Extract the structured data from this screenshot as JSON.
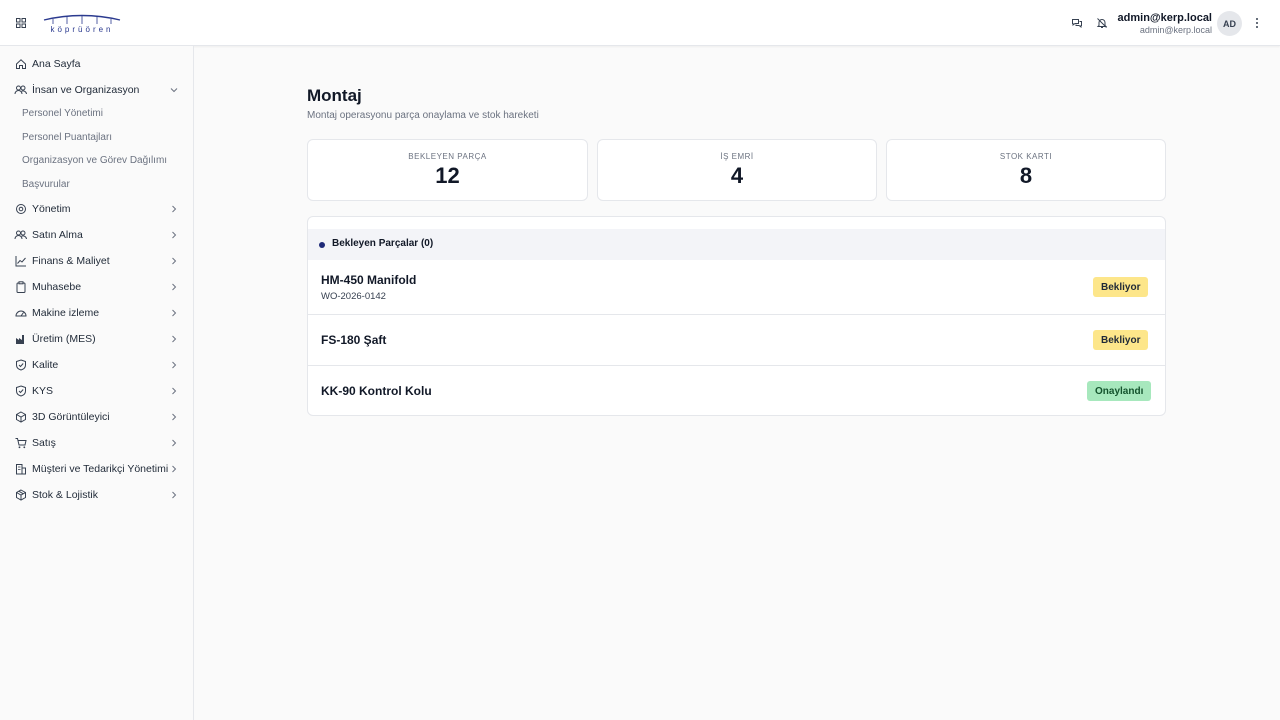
{
  "header": {
    "logo_text": "köprüören",
    "user_name": "admin@kerp.local",
    "user_email": "admin@kerp.local",
    "avatar_initials": "AD"
  },
  "sidebar": {
    "home": "Ana Sayfa",
    "hr": {
      "label": "İnsan ve Organizasyon",
      "sub": [
        "Personel Yönetimi",
        "Personel Puantajları",
        "Organizasyon ve Görev Dağılımı",
        "Başvurular"
      ]
    },
    "items": [
      "Yönetim",
      "Satın Alma",
      "Finans & Maliyet",
      "Muhasebe",
      "Makine izleme",
      "Üretim (MES)",
      "Kalite",
      "KYS",
      "3D Görüntüleyici",
      "Satış",
      "Müşteri ve Tedarikçi Yönetimi",
      "Stok & Lojistik"
    ]
  },
  "page": {
    "title": "Montaj",
    "subtitle": "Montaj operasyonu parça onaylama ve stok hareketi"
  },
  "stats": [
    {
      "label": "BEKLEYEN PARÇA",
      "value": "12"
    },
    {
      "label": "İŞ EMRİ",
      "value": "4"
    },
    {
      "label": "STOK KARTI",
      "value": "8"
    }
  ],
  "list": {
    "title": "Bekleyen Parçalar (0)",
    "rows": [
      {
        "name": "HM-450 Manifold",
        "sub": "WO-2026-0142",
        "status": "Bekliyor"
      },
      {
        "name": "FS-180 Şaft",
        "sub": "",
        "status": "Bekliyor"
      },
      {
        "name": "KK-90 Kontrol Kolu",
        "sub": "",
        "status": "Onaylandı"
      }
    ]
  },
  "colors": {
    "pending": "#fde68a",
    "approved": "#a7e8bd",
    "accent": "#1e2a78"
  }
}
